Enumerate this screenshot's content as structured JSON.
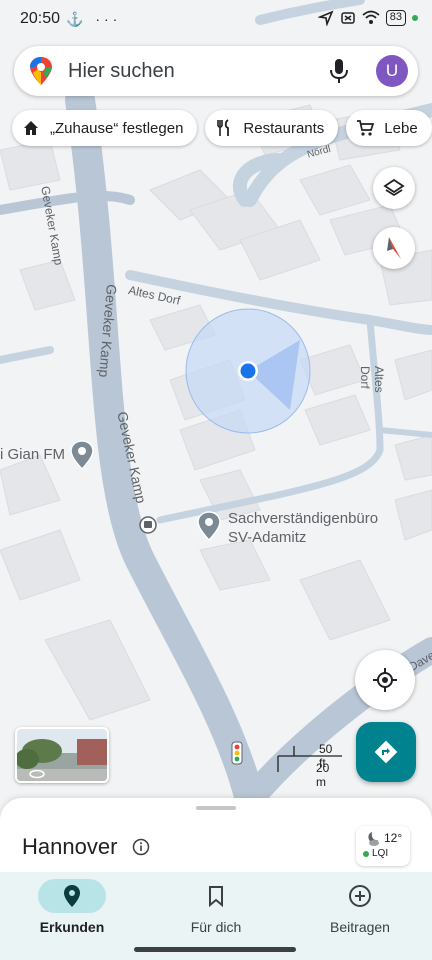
{
  "status_bar": {
    "time": "20:50",
    "left_icons": "⚓ ···",
    "battery": "83"
  },
  "search": {
    "placeholder": "Hier suchen",
    "avatar_initial": "U"
  },
  "chips": [
    {
      "label": "„Zuhause“ festlegen",
      "icon": "home-icon"
    },
    {
      "label": "Restaurants",
      "icon": "fork-knife-icon"
    },
    {
      "label": "Lebe",
      "icon": "shopping-cart-icon"
    }
  ],
  "map": {
    "streets": [
      "Geveker Kamp",
      "Geveker Kamp",
      "Altes Dorf",
      "Altes Dorf",
      "Daven",
      "Nördl"
    ],
    "places": [
      {
        "name": "Sachverständigenbüro",
        "name2": "SV-Adamitz"
      },
      {
        "name": "i Gian FM"
      }
    ],
    "scale": {
      "top": "50 ft",
      "bottom": "20 m"
    }
  },
  "sheet": {
    "title": "Hannover",
    "weather": {
      "temperature": "12°",
      "aqi": "LQI"
    }
  },
  "nav": [
    {
      "label": "Erkunden",
      "icon": "location-pin-icon",
      "active": true
    },
    {
      "label": "Für dich",
      "icon": "bookmark-icon",
      "active": false
    },
    {
      "label": "Beitragen",
      "icon": "plus-circle-icon",
      "active": false
    }
  ],
  "colors": {
    "accent": "#00838f",
    "avatar": "#7e57c2",
    "nav_active": "#b8e4e8",
    "location": "#1a73e8"
  }
}
